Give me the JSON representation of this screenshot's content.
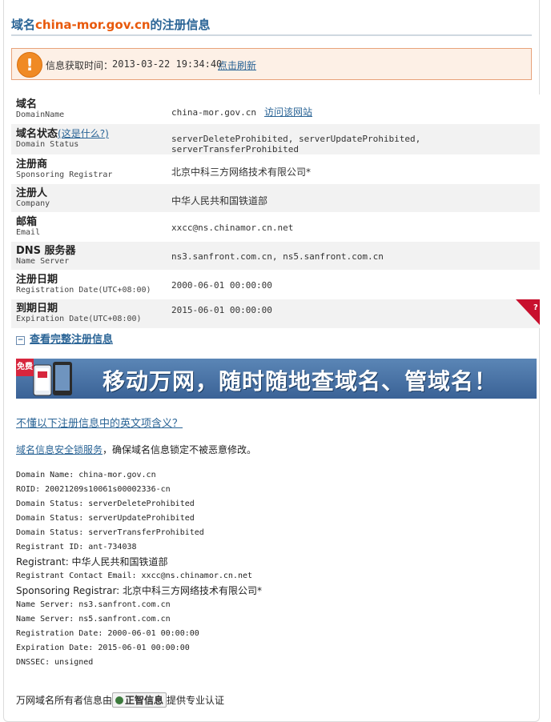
{
  "title": {
    "prefix": "域名",
    "domain": "china-mor.gov.cn",
    "suffix": "的注册信息"
  },
  "notice": {
    "label": "信息获取时间：",
    "time": "2013-03-22 19:34:40",
    "refresh": "点击刷新"
  },
  "rows": [
    {
      "zh": "域名",
      "en": "DomainName",
      "value": "china-mor.gov.cn",
      "link": "访问该网站"
    },
    {
      "zh": "域名状态",
      "whatis": "(这是什么?)",
      "en": "Domain Status",
      "value": "serverDeleteProhibited, serverUpdateProhibited, serverTransferProhibited"
    },
    {
      "zh": "注册商",
      "en": "Sponsoring Registrar",
      "value": "北京中科三方网络技术有限公司*"
    },
    {
      "zh": "注册人",
      "en": "Company",
      "value": "中华人民共和国铁道部"
    },
    {
      "zh": "邮箱",
      "en": "Email",
      "value": "xxcc@ns.chinamor.cn.net"
    },
    {
      "zh": "DNS 服务器",
      "en": "Name Server",
      "value": "ns3.sanfront.com.cn, ns5.sanfront.com.cn"
    },
    {
      "zh": "注册日期",
      "en": "Registration Date(UTC+08:00)",
      "value": "2000-06-01 00:00:00"
    },
    {
      "zh": "到期日期",
      "en": "Expiration Date(UTC+08:00)",
      "value": "2015-06-01 00:00:00"
    }
  ],
  "expand": {
    "box": "−",
    "label": "查看完整注册信息"
  },
  "banner": {
    "free": "免费",
    "text": "移动万网，随时随地查域名、管域名！"
  },
  "question": "不懂以下注册信息中的英文项含义？",
  "lock": {
    "link": "域名信息安全锁服务",
    "text": "，确保域名信息锁定不被恶意修改。"
  },
  "whois": [
    "Domain Name: china-mor.gov.cn",
    "ROID: 20021209s10061s00002336-cn",
    "Domain Status: serverDeleteProhibited",
    "Domain Status: serverUpdateProhibited",
    "Domain Status: serverTransferProhibited",
    "Registrant ID: ant-734038",
    "Registrant: 中华人民共和国铁道部",
    "Registrant Contact Email: xxcc@ns.chinamor.cn.net",
    "Sponsoring Registrar: 北京中科三方网络技术有限公司*",
    "Name Server: ns3.sanfront.com.cn",
    "Name Server: ns5.sanfront.com.cn",
    "Registration Date: 2000-06-01 00:00:00",
    "Expiration Date: 2015-06-01 00:00:00",
    "DNSSEC: unsigned"
  ],
  "footer": {
    "before": "万网域名所有者信息由",
    "badge": "正智信息",
    "after": "提供专业认证"
  },
  "colors": {
    "link": "#2a6496",
    "domain": "#e8590c",
    "warn": "#f08a24",
    "banner": "#3a6296",
    "corner": "#c8102e"
  },
  "icons": {
    "warn": "exclamation-icon",
    "corner": "help-corner-icon"
  }
}
